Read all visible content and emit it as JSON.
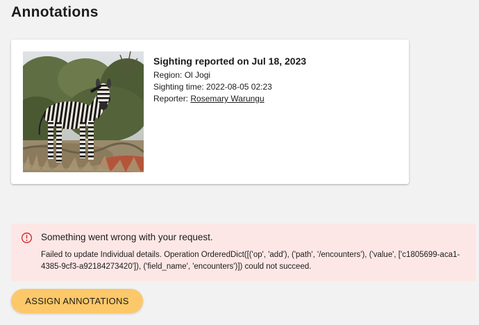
{
  "page": {
    "title": "Annotations"
  },
  "sighting": {
    "title": "Sighting reported on Jul 18, 2023",
    "region_label": "Region:",
    "region": "Ol Jogi",
    "time_label": "Sighting time:",
    "time": "2022-08-05 02:23",
    "reporter_label": "Reporter:",
    "reporter": "Rosemary Warungu",
    "photo_subject": "zebra"
  },
  "alert": {
    "icon": "error-circle-icon",
    "color": "#d32f2f",
    "background": "#fde7e6",
    "title": "Something went wrong with your request.",
    "message": "Failed to update Individual details. Operation OrderedDict([('op', 'add'), ('path', '/encounters'), ('value', ['c1805699-aca1-4385-9cf3-a92184273420']), ('field_name', 'encounters')]) could not succeed."
  },
  "actions": {
    "assign_label": "ASSIGN ANNOTATIONS",
    "assign_color": "#fdc869"
  }
}
